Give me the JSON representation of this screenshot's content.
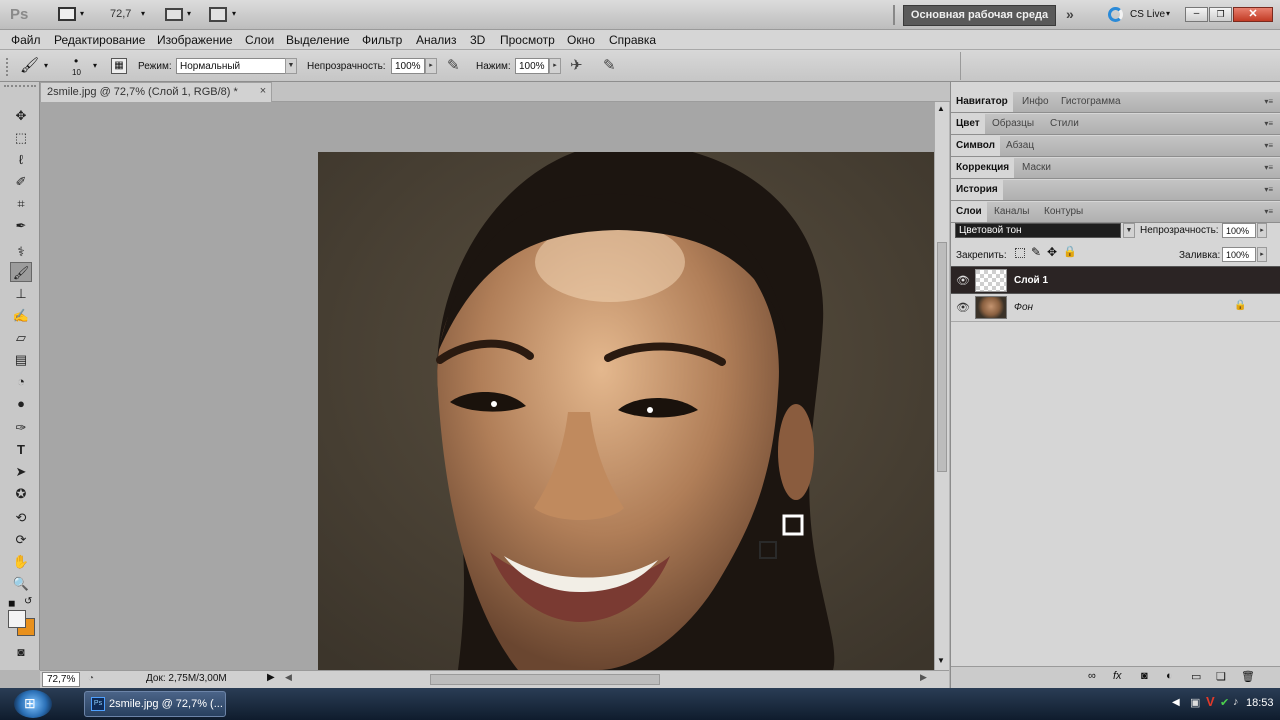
{
  "appbar": {
    "logo": "Ps",
    "zoom": "72,7",
    "workspace": "Основная рабочая среда",
    "cs_live": "CS Live",
    "cs_live_caret": "▾"
  },
  "menu": [
    "Файл",
    "Редактирование",
    "Изображение",
    "Слои",
    "Выделение",
    "Фильтр",
    "Анализ",
    "3D",
    "Просмотр",
    "Окно",
    "Справка"
  ],
  "options": {
    "brush_size": "10",
    "mode_label": "Режим:",
    "mode_value": "Нормальный",
    "opacity_label": "Непрозрачность:",
    "opacity_value": "100%",
    "flow_label": "Нажим:",
    "flow_value": "100%"
  },
  "document": {
    "tab_title": "2smile.jpg @ 72,7% (Слой 1, RGB/8) *",
    "close": "×"
  },
  "status": {
    "zoom": "72,7%",
    "doc_info": "Док: 2,75M/3,00M"
  },
  "panels": {
    "row1": [
      "Навигатор",
      "Инфо",
      "Гистограмма"
    ],
    "row2": [
      "Цвет",
      "Образцы",
      "Стили"
    ],
    "row3": [
      "Символ",
      "Абзац"
    ],
    "row4": [
      "Коррекция",
      "Маски"
    ],
    "row5": [
      "История"
    ],
    "layers_tabs": [
      "Слои",
      "Каналы",
      "Контуры"
    ],
    "blend_mode": "Цветовой тон",
    "opacity_label": "Непрозрачность:",
    "opacity_value": "100%",
    "lock_label": "Закрепить:",
    "fill_label": "Заливка:",
    "fill_value": "100%",
    "layers": [
      {
        "name": "Слой 1",
        "selected": true
      },
      {
        "name": "Фон",
        "selected": false
      }
    ]
  },
  "taskbar": {
    "task_label": "2smile.jpg @ 72,7% (...",
    "clock": "18:53"
  },
  "colors": {
    "selected_layer": "#2b2424",
    "foreground": "#f4f4f4",
    "background": "#e8901c"
  }
}
